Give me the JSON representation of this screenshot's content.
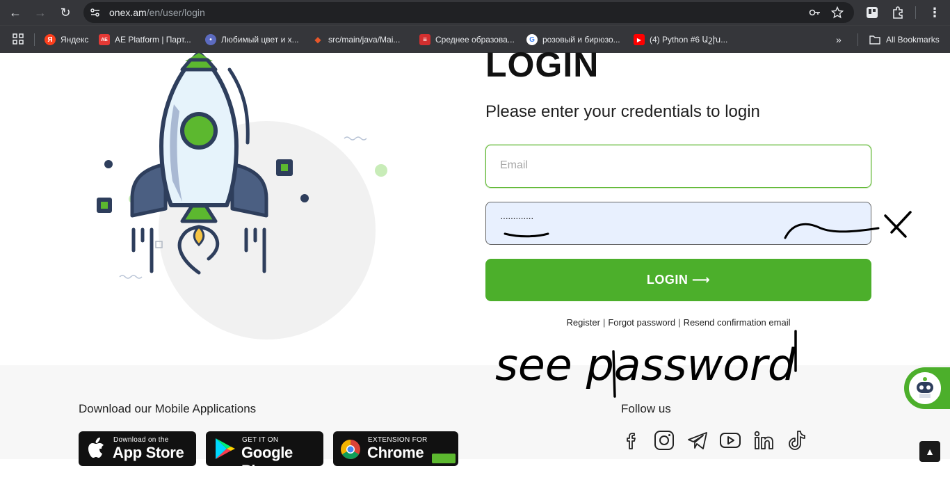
{
  "browser": {
    "url_host": "onex.am",
    "url_path": "/en/user/login",
    "bookmarks": [
      {
        "label": "Яндекс",
        "color": "#fc3f1d",
        "glyph": "Я"
      },
      {
        "label": "AE Platform | Парт...",
        "color": "#e53935",
        "glyph": "AE"
      },
      {
        "label": "Любимый цвет и х...",
        "color": "#5c6bc0",
        "glyph": "•"
      },
      {
        "label": "src/main/java/Mai...",
        "color": "#e8572a",
        "glyph": "◆"
      },
      {
        "label": "Среднее образова...",
        "color": "#d32f2f",
        "glyph": "≡"
      },
      {
        "label": "розовый и бирюзо...",
        "color": "#4285f4",
        "glyph": "G"
      },
      {
        "label": "(4) Python #6 Աշխ...",
        "color": "#ff0000",
        "glyph": "▶"
      }
    ],
    "all_bookmarks": "All Bookmarks"
  },
  "login": {
    "title": "LOGIN",
    "subtitle": "Please enter your credentials to login",
    "email_placeholder": "Email",
    "password_mask": "·············",
    "button_label": "LOGIN ⟶",
    "register": "Register",
    "forgot": "Forgot password",
    "resend": "Resend confirmation email",
    "sep": "|"
  },
  "annotation": {
    "handwritten_note": "see password"
  },
  "footer": {
    "apps_heading": "Download our Mobile Applications",
    "follow_heading": "Follow us",
    "stores": [
      {
        "small": "Download on the",
        "big": "App Store"
      },
      {
        "small": "GET IT ON",
        "big": "Google Play"
      },
      {
        "small": "EXTENSION FOR",
        "big": "Chrome"
      }
    ],
    "socials": [
      "facebook-icon",
      "instagram-icon",
      "telegram-icon",
      "youtube-icon",
      "linkedin-icon",
      "tiktok-icon"
    ]
  },
  "colors": {
    "brand_green": "#4caf2b",
    "rocket_navy": "#2e3e5c",
    "chrome_dark": "#35363a"
  }
}
